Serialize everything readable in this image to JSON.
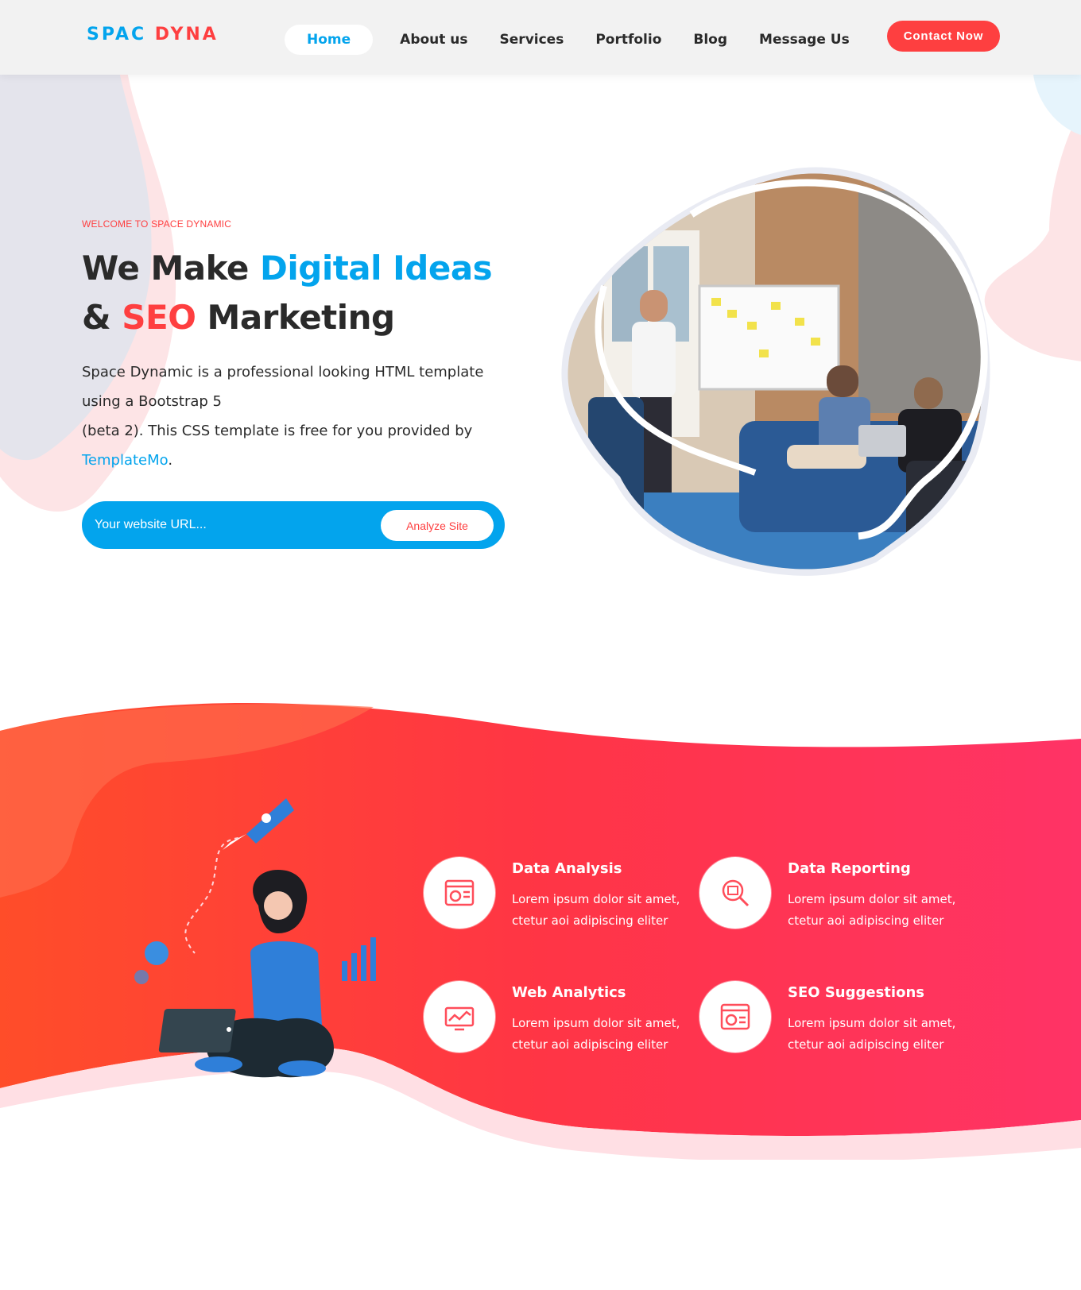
{
  "header": {
    "logo_part1": "SPAC",
    "logo_part2": "DYNA",
    "nav": [
      {
        "label": "Home",
        "active": true
      },
      {
        "label": "About us",
        "active": false
      },
      {
        "label": "Services",
        "active": false
      },
      {
        "label": "Portfolio",
        "active": false
      },
      {
        "label": "Blog",
        "active": false
      },
      {
        "label": "Message Us",
        "active": false
      }
    ],
    "contact_button": "Contact Now"
  },
  "hero": {
    "welcome": "WELCOME TO SPACE DYNAMIC",
    "title_part1": "We Make",
    "title_highlight1": "Digital Ideas",
    "title_part2": "&",
    "title_highlight2": "SEO",
    "title_part3": "Marketing",
    "description_line1": "Space Dynamic is a professional looking HTML template using a Bootstrap 5",
    "description_line2": "(beta 2). This CSS template is free for you provided by",
    "description_link": "TemplateMo",
    "description_end": ".",
    "url_placeholder": "Your website URL...",
    "analyze_button": "Analyze Site",
    "image_icon": "team-meeting-photo"
  },
  "services": [
    {
      "title": "Data Analysis",
      "text": "Lorem ipsum dolor sit amet, ctetur aoi adipiscing eliter",
      "icon": "chart-dashboard-icon"
    },
    {
      "title": "Data Reporting",
      "text": "Lorem ipsum dolor sit amet, ctetur aoi adipiscing eliter",
      "icon": "magnifier-report-icon"
    },
    {
      "title": "Web Analytics",
      "text": "Lorem ipsum dolor sit amet, ctetur aoi adipiscing eliter",
      "icon": "analytics-monitor-icon"
    },
    {
      "title": "SEO Suggestions",
      "text": "Lorem ipsum dolor sit amet, ctetur aoi adipiscing eliter",
      "icon": "browser-chart-icon"
    }
  ],
  "colors": {
    "brand_blue": "#03a4ed",
    "brand_red": "#fe3f40",
    "services_gradient_start": "#ff4d29",
    "services_gradient_end": "#ff3366"
  }
}
